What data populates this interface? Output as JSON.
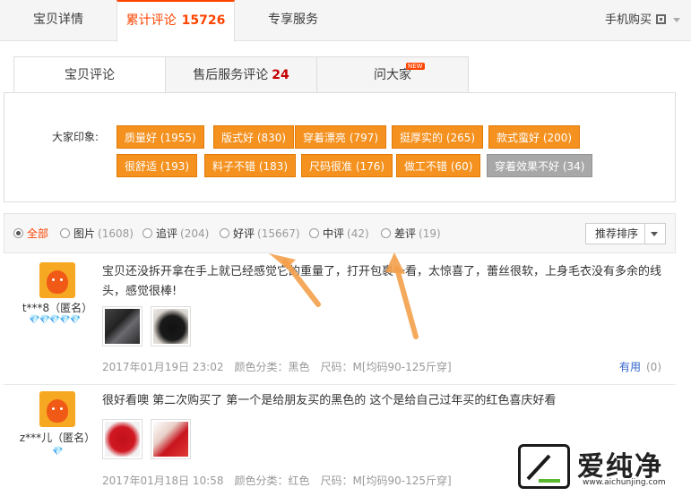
{
  "top_tabs": [
    {
      "label": "宝贝详情"
    },
    {
      "label": "累计评论",
      "count": "15726"
    },
    {
      "label": "专享服务"
    }
  ],
  "mobile_buy": "手机购买",
  "sub_tabs": [
    {
      "label": "宝贝评论"
    },
    {
      "label": "售后服务评论",
      "count": "24"
    },
    {
      "label": "问大家",
      "badge": "NEW"
    }
  ],
  "impressions": {
    "label": "大家印象:",
    "tags": [
      "质量好 (1955)",
      "版式好 (830)",
      "穿着漂亮 (797)",
      "挺厚实的 (265)",
      "款式蛮好 (200)",
      "很舒适 (193)",
      "料子不错 (183)",
      "尺码很准 (176)",
      "做工不错 (60)",
      "穿着效果不好 (34)"
    ]
  },
  "filters": [
    {
      "label": "全部",
      "count": ""
    },
    {
      "label": "图片",
      "count": "(1608)"
    },
    {
      "label": "追评",
      "count": "(204)"
    },
    {
      "label": "好评",
      "count": "(15667)"
    },
    {
      "label": "中评",
      "count": "(42)"
    },
    {
      "label": "差评",
      "count": "(19)"
    }
  ],
  "sort_label": "推荐排序",
  "reviews": [
    {
      "user": "t***8（匿名）",
      "hearts": "💎💎💎💎💎",
      "content": "宝贝还没拆开拿在手上就已经感觉它的重量了，打开包裹一看，太惊喜了，蕾丝很软，上身毛衣没有多余的线头，感觉很棒!",
      "date": "2017年01月19日 23:02",
      "color": "颜色分类：黑色",
      "size": "尺码：M[均码90-125斤穿]",
      "useful_label": "有用",
      "useful_count": "(0)"
    },
    {
      "user": "z***儿（匿名）",
      "hearts": "💎",
      "content": "很好看噢 第二次购买了 第一个是给朋友买的黑色的 这个是给自己过年买的红色喜庆好看",
      "date": "2017年01月18日 10:58",
      "color": "颜色分类：红色",
      "size": "尺码：M[均码90-125斤穿]"
    }
  ],
  "watermark": {
    "text": "爱纯净",
    "url": "www.aichunjing.com"
  },
  "colors": {
    "accent": "#ff4400",
    "tag": "#f4911f",
    "tag_grey": "#a8a8a8",
    "arrow": "#f4a04b"
  }
}
